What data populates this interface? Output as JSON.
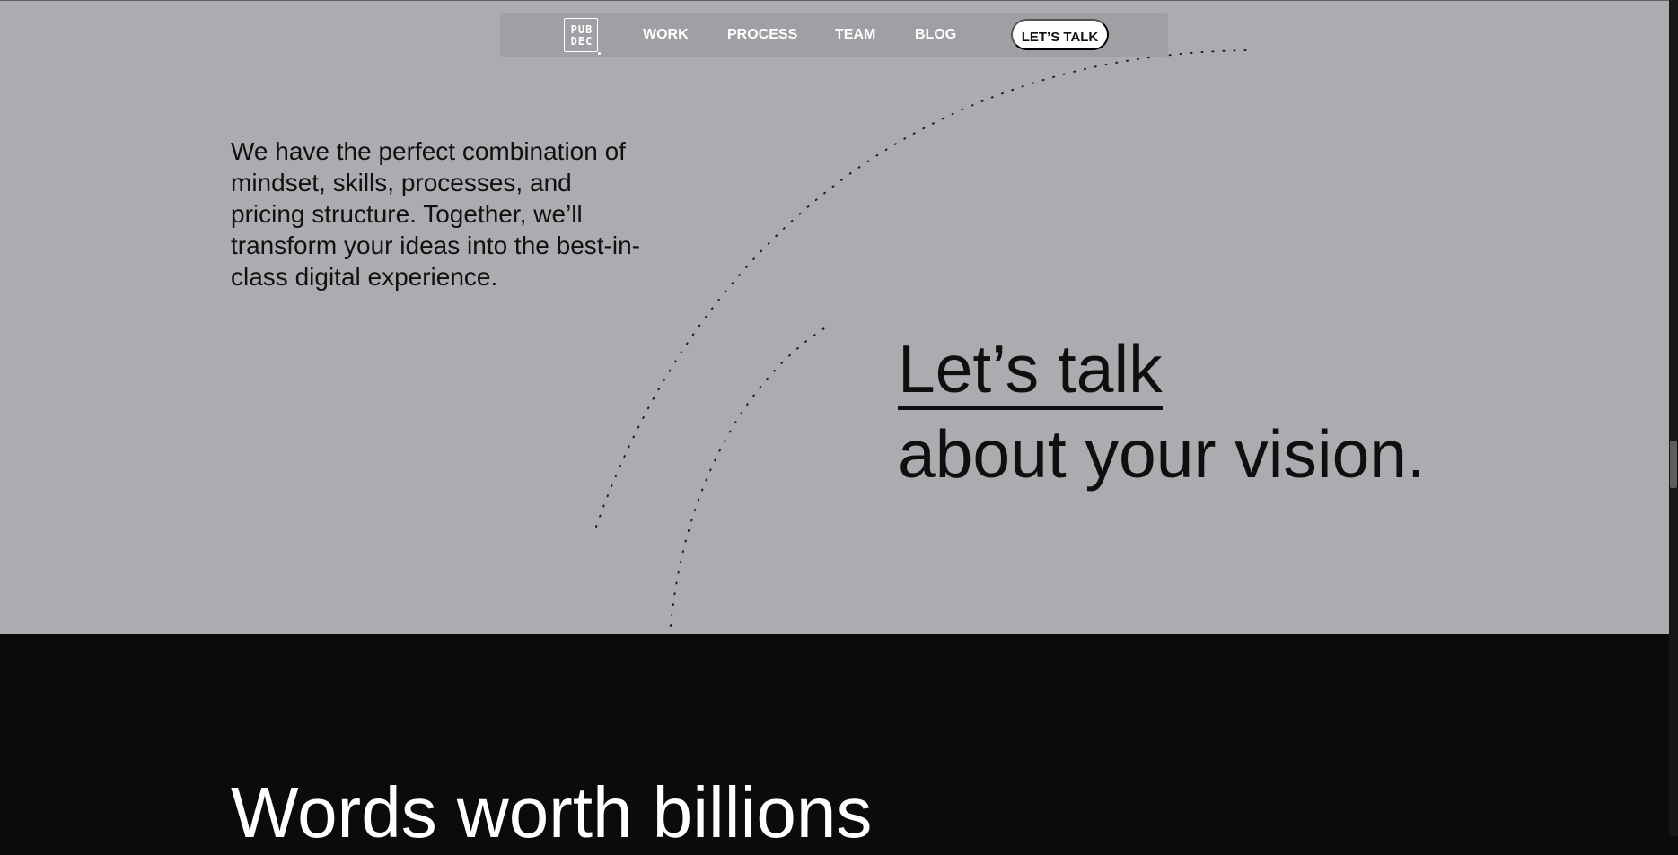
{
  "nav": {
    "logo_text": {
      "line1": "PUB",
      "line2": "DEC"
    },
    "links": {
      "work": "WORK",
      "process": "PROCESS",
      "team": "TEAM",
      "blog": "BLOG"
    },
    "cta": "LET’S TALK"
  },
  "intro": {
    "text": "We have the perfect combination of mindset, skills, processes, and pricing structure. Together, we’ll transform your ideas into the best-in-class digital experience."
  },
  "talk_block": {
    "link": "Let’s talk",
    "line2": "about your vision."
  },
  "next_section": {
    "title": "Words worth billions"
  },
  "colors": {
    "top_background": "#abacaf",
    "navbar_background": "#9fa0a3",
    "bottom_background": "#0b0b0b",
    "text_dark": "#111111",
    "text_light": "#ffffff"
  }
}
